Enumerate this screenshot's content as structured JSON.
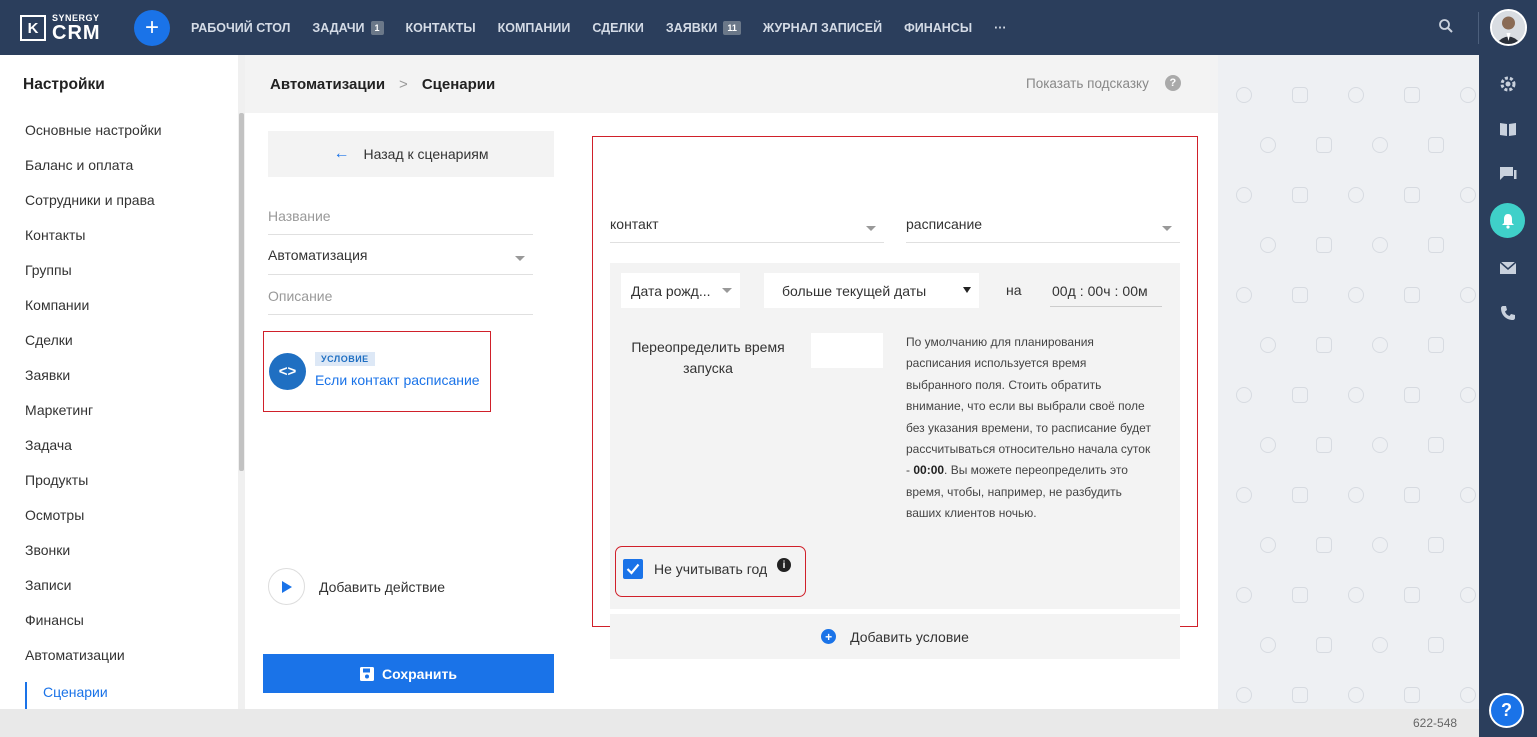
{
  "brand": {
    "logo_small": "SYNERGY",
    "logo_big": "CRM",
    "logo_mark": "K"
  },
  "topnav": {
    "items": [
      {
        "label": "РАБОЧИЙ СТОЛ",
        "badge": ""
      },
      {
        "label": "ЗАДАЧИ",
        "badge": "1"
      },
      {
        "label": "КОНТАКТЫ",
        "badge": ""
      },
      {
        "label": "КОМПАНИИ",
        "badge": ""
      },
      {
        "label": "СДЕЛКИ",
        "badge": ""
      },
      {
        "label": "ЗАЯВКИ",
        "badge": "11"
      },
      {
        "label": "ЖУРНАЛ ЗАПИСЕЙ",
        "badge": ""
      },
      {
        "label": "ФИНАНСЫ",
        "badge": ""
      }
    ],
    "more": "···",
    "plus": "+"
  },
  "sidebar": {
    "title": "Настройки",
    "items": [
      "Основные настройки",
      "Баланс и оплата",
      "Сотрудники и права",
      "Контакты",
      "Группы",
      "Компании",
      "Сделки",
      "Заявки",
      "Маркетинг",
      "Задача",
      "Продукты",
      "Осмотры",
      "Звонки",
      "Записи",
      "Финансы",
      "Автоматизации"
    ],
    "active": "Сценарии"
  },
  "breadcrumb": {
    "parent": "Автоматизации",
    "separator": ">",
    "current": "Сценарии"
  },
  "hint": {
    "label": "Показать подсказку",
    "icon": "?"
  },
  "scenario": {
    "back_label": "Назад к сценариям",
    "back_arrow": "←",
    "name_label": "Название",
    "name_value": "Автоматизация",
    "description_label": "Описание",
    "condition_tag": "УСЛОВИЕ",
    "condition_text": "Если контакт расписание",
    "condition_icon": "<>",
    "add_action_label": "Добавить действие",
    "save_label": "Сохранить"
  },
  "condition": {
    "entity": "контакт",
    "trigger": "расписание",
    "field": "Дата рожд...",
    "operator": "больше текущей даты",
    "on_label": "на",
    "time": {
      "days": "00",
      "days_unit": "д",
      "hours": "00",
      "hours_unit": "ч",
      "minutes": "00",
      "minutes_unit": "м",
      "sep": ":"
    },
    "override_label": "Переопределить время запуска",
    "note_before": "По умолчанию для планирования расписания используется время выбранного поля. Стоить обратить внимание, что если вы выбрали своё поле без указания времени, то расписание будет рассчитываться относительно начала суток - ",
    "note_bold": "00:00",
    "note_after": ". Вы можете переопределить это время, чтобы, например, не разбудить ваших клиентов ночью.",
    "ignore_year_label": "Не учитывать год",
    "ignore_year_checked": true,
    "info_icon": "i",
    "add_condition_label": "Добавить условие",
    "add_condition_icon": "+"
  },
  "right_bar": {
    "help_icon": "?"
  },
  "footer": {
    "version": "622-548"
  },
  "colors": {
    "topbar": "#2b3e5c",
    "accent": "#1a73e8",
    "highlight": "#d0202a",
    "bell": "#3fd0c9"
  }
}
